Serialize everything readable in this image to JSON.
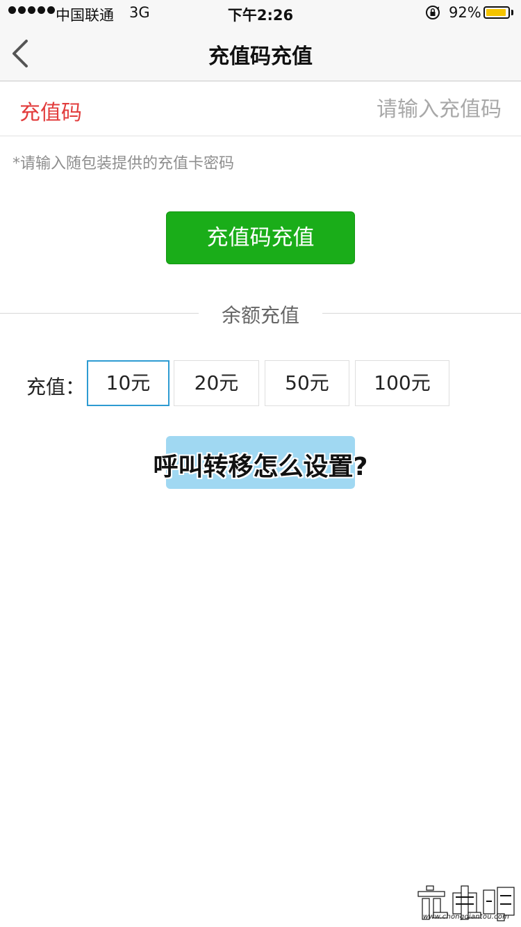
{
  "status_bar": {
    "signal_dots": "●●●●●",
    "carrier": "中国联通",
    "network": "3G",
    "time": "下午2:26",
    "battery_percent": "92%",
    "battery_level": 0.92,
    "battery_color": "#f5c400",
    "icons": [
      "signal-dots-icon",
      "orientation-lock-icon",
      "battery-icon"
    ]
  },
  "nav": {
    "back_icon": "chevron-left-icon",
    "title": "充值码充值"
  },
  "code_field": {
    "label": "充值码",
    "placeholder": "请输入充值码",
    "value": "",
    "label_color": "#e23c3c"
  },
  "hint": "*请输入随包装提供的充值卡密码",
  "redeem_button": {
    "label": "充值码充值",
    "color": "#1aad19"
  },
  "balance_section": {
    "divider_label": "余额充值",
    "amount_label": "充值：",
    "options": [
      "10元",
      "20元",
      "50元",
      "100元"
    ],
    "selected_index": 0,
    "selected_color": "#2d9bd2",
    "button_color": "#a0d8f2"
  },
  "overlay": {
    "title": "呼叫转移怎么设置?"
  },
  "watermark": {
    "logo_text": "充电明",
    "domain": "www.chongdiantou.com"
  }
}
